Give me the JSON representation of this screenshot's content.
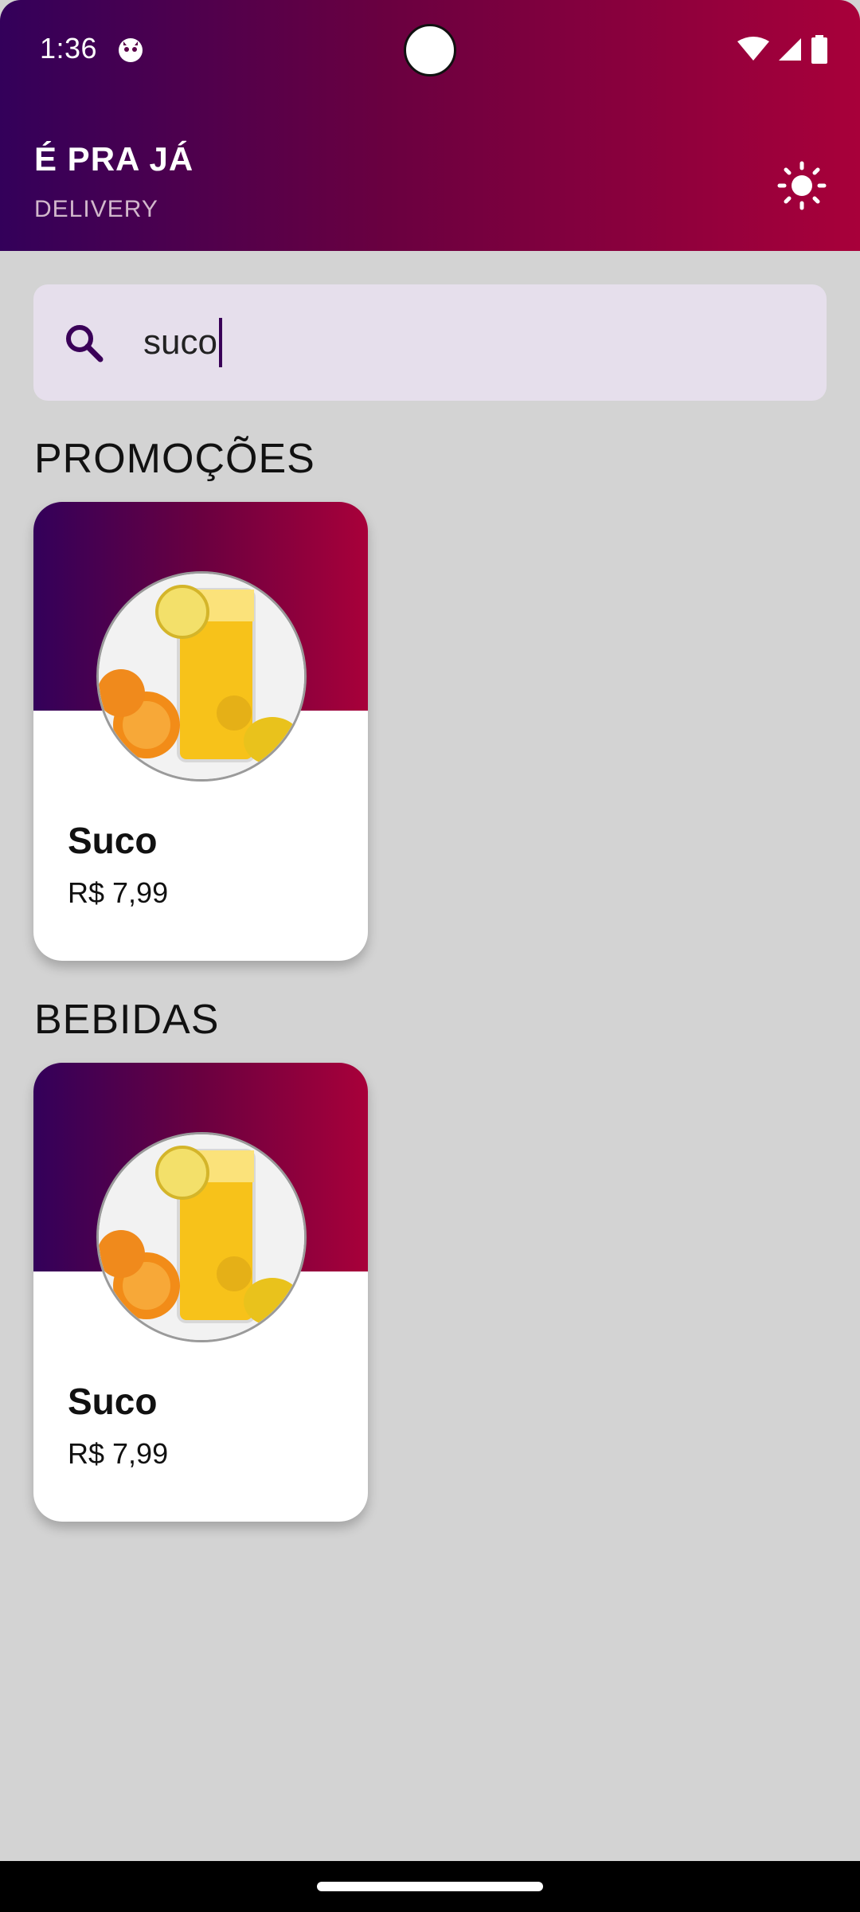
{
  "status_bar": {
    "time": "1:36",
    "icons": [
      "app-notification-icon",
      "wifi-icon",
      "cellular-signal-icon",
      "battery-icon"
    ]
  },
  "header": {
    "title": "É PRA JÁ",
    "subtitle": "DELIVERY",
    "theme_toggle_icon": "sun-icon",
    "gradient": [
      "#33005a",
      "#a8003a"
    ]
  },
  "search": {
    "value": "suco",
    "icon": "search-icon"
  },
  "sections": [
    {
      "title": "PROMOÇÕES",
      "items": [
        {
          "name": "Suco",
          "price": "R$ 7,99",
          "image": "orange-juice-glass"
        }
      ]
    },
    {
      "title": "BEBIDAS",
      "items": [
        {
          "name": "Suco",
          "price": "R$ 7,99",
          "image": "orange-juice-glass"
        }
      ]
    }
  ]
}
